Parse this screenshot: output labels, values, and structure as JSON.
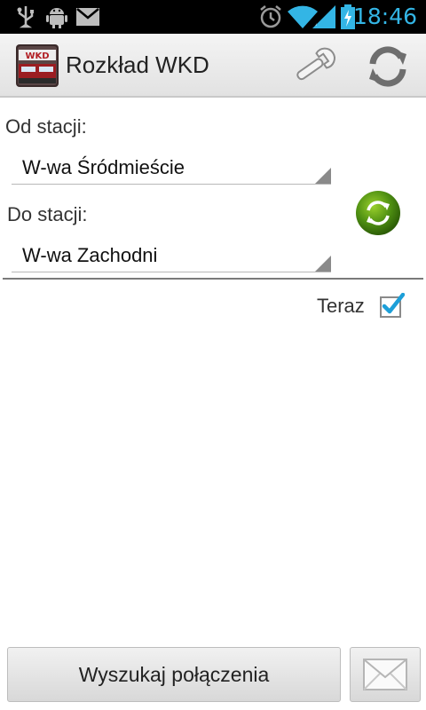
{
  "status_bar": {
    "time": "18:46",
    "icons": [
      "usb-icon",
      "android-debug-icon",
      "mail-notification-icon",
      "alarm-icon",
      "wifi-icon",
      "signal-icon",
      "battery-charging-icon"
    ],
    "accent_color": "#33b5e5"
  },
  "app": {
    "title": "Rozkład WKD",
    "logo_text": "WKD",
    "actions": [
      "settings-wrench-icon",
      "refresh-icon"
    ]
  },
  "form": {
    "from_label": "Od stacji:",
    "from_value": "W-wa Śródmieście",
    "to_label": "Do stacji:",
    "to_value": "W-wa Zachodni",
    "now_label": "Teraz",
    "now_checked": true
  },
  "buttons": {
    "search_label": "Wyszukaj połączenia",
    "mail_icon": "envelope-icon"
  }
}
